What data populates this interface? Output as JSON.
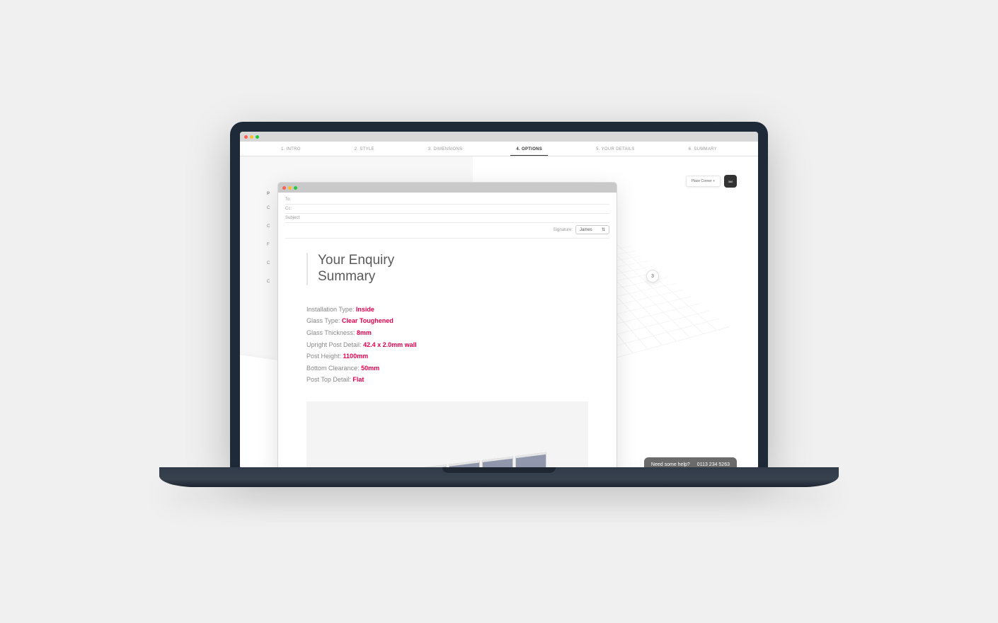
{
  "nav": {
    "tabs": [
      {
        "label": "1. INTRO",
        "active": false
      },
      {
        "label": "2. STYLE",
        "active": false
      },
      {
        "label": "3. DIMENSIONS",
        "active": false
      },
      {
        "label": "4. OPTIONS",
        "active": true
      },
      {
        "label": "5. YOUR DETAILS",
        "active": false
      },
      {
        "label": "6. SUMMARY",
        "active": false
      }
    ]
  },
  "side_panel": {
    "section_label": "P",
    "options": [
      "C",
      "C",
      "F",
      "C",
      "C"
    ]
  },
  "viewport": {
    "place_button": "Place Corner +",
    "view_360_label": "360",
    "marker_label": "3"
  },
  "help": {
    "text": "Need some help?",
    "phone": "0113 234 5263"
  },
  "email": {
    "to_label": "To:",
    "cc_label": "Cc:",
    "subject_label": "Subject:",
    "signature_label": "Signature:",
    "signature_value": "James"
  },
  "summary": {
    "title_line1": "Your Enquiry",
    "title_line2": "Summary",
    "rows": [
      {
        "label": "Installation Type:",
        "value": "Inside"
      },
      {
        "label": "Glass Type:",
        "value": "Clear Toughened"
      },
      {
        "label": "Glass Thickness:",
        "value": "8mm"
      },
      {
        "label": "Upright Post Detail:",
        "value": "42.4 x 2.0mm wall"
      },
      {
        "label": "Post Height:",
        "value": "1100mm"
      },
      {
        "label": "Bottom Clearance:",
        "value": "50mm"
      },
      {
        "label": "Post Top Detail:",
        "value": "Flat"
      }
    ]
  }
}
